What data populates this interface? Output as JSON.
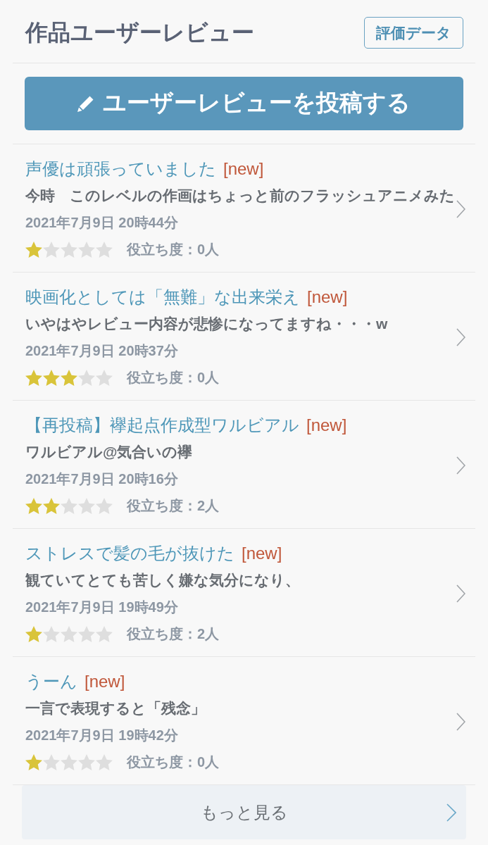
{
  "header": {
    "title": "作品ユーザーレビュー",
    "rating_data_button": "評価データ"
  },
  "post_button": {
    "label": "ユーザーレビューを投稿する"
  },
  "reviews": [
    {
      "title": "声優は頑張っていました",
      "badge": "[new]",
      "snippet": "今時　このレベルの作画はちょっと前のフラッシュアニメみた",
      "date": "2021年7月9日 20時44分",
      "stars": 1,
      "helpful": "役立ち度：0人"
    },
    {
      "title": "映画化としては「無難」な出来栄え",
      "badge": "[new]",
      "snippet": "いやはやレビュー内容が悲惨になってますね・・・w",
      "date": "2021年7月9日 20時37分",
      "stars": 3,
      "helpful": "役立ち度：0人"
    },
    {
      "title": "【再投稿】襷起点作成型ワルビアル",
      "badge": "[new]",
      "snippet": "ワルビアル@気合いの襷",
      "date": "2021年7月9日 20時16分",
      "stars": 2,
      "helpful": "役立ち度：2人"
    },
    {
      "title": "ストレスで髪の毛が抜けた",
      "badge": "[new]",
      "snippet": "観ていてとても苦しく嫌な気分になり、",
      "date": "2021年7月9日 19時49分",
      "stars": 1,
      "helpful": "役立ち度：2人"
    },
    {
      "title": "うーん",
      "badge": "[new]",
      "snippet": "一言で表現すると「残念」",
      "date": "2021年7月9日 19時42分",
      "stars": 1,
      "helpful": "役立ち度：0人"
    }
  ],
  "more_button": {
    "label": "もっと見る"
  }
}
